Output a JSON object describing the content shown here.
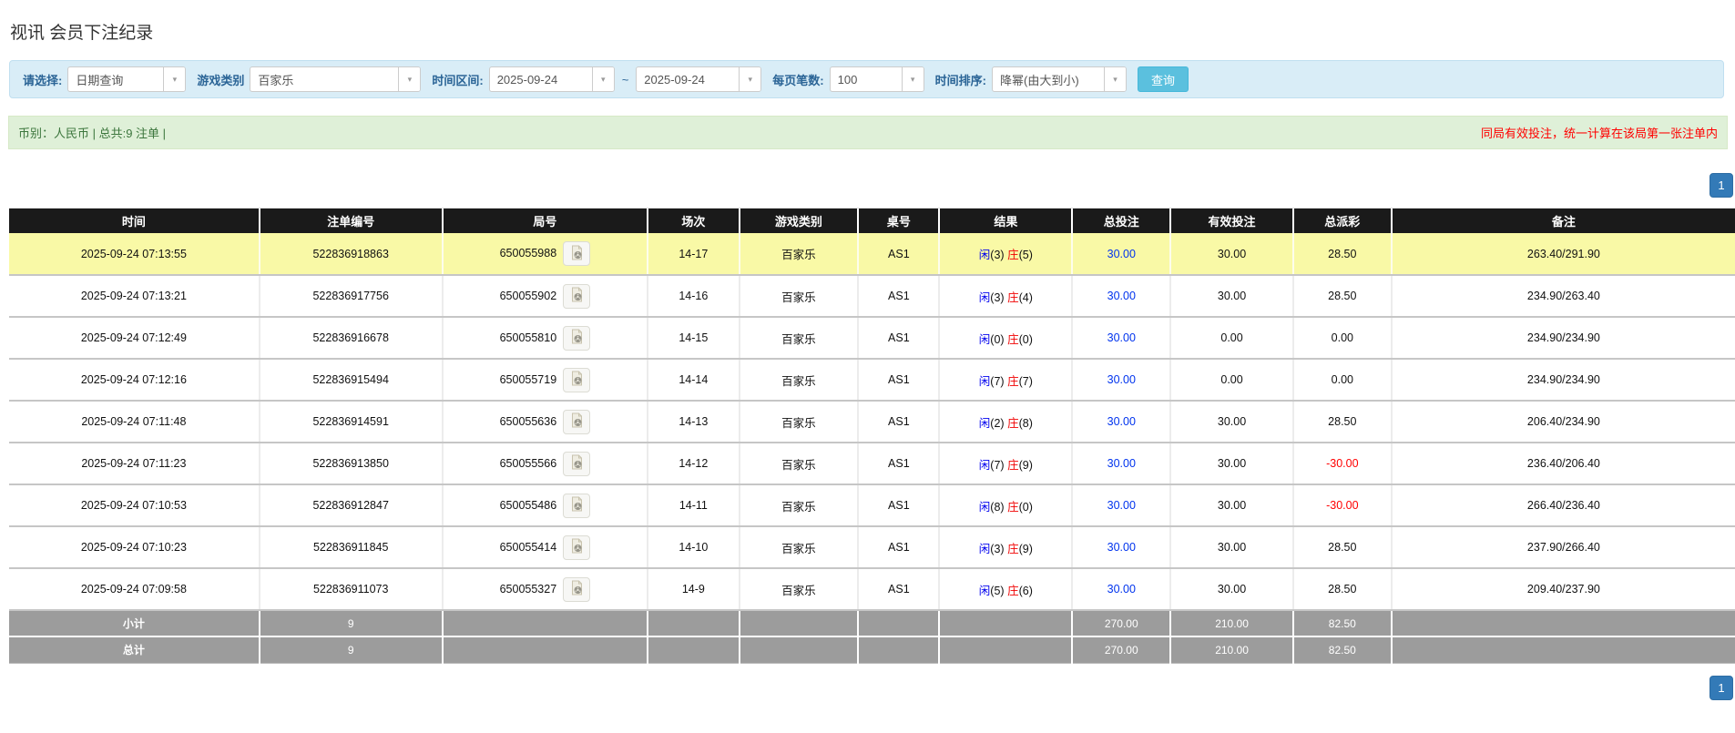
{
  "title": "视讯 会员下注纪录",
  "filters": {
    "query_type": {
      "label": "请选择:",
      "value": "日期查询"
    },
    "game_type": {
      "label": "游戏类别",
      "value": "百家乐"
    },
    "time_range": {
      "label": "时间区间:",
      "from": "2025-09-24",
      "separator": "~",
      "to": "2025-09-24"
    },
    "page_size": {
      "label": "每页笔数:",
      "value": "100"
    },
    "time_sort": {
      "label": "时间排序:",
      "value": "降幂(由大到小)"
    },
    "search_button": "查询"
  },
  "summary": {
    "currency_info": "币别：人民币 | 总共:9 注单 |",
    "note": "同局有效投注，统一计算在该局第一张注单内"
  },
  "pagination": {
    "current_page": "1"
  },
  "table": {
    "headers": [
      "时间",
      "注单编号",
      "局号",
      "场次",
      "游戏类别",
      "桌号",
      "结果",
      "总投注",
      "有效投注",
      "总派彩",
      "备注"
    ],
    "rows": [
      {
        "time": "2025-09-24 07:13:55",
        "bet_no": "522836918863",
        "round_no": "650055988",
        "session": "14-17",
        "game": "百家乐",
        "table_no": "AS1",
        "result": {
          "player": "闲",
          "player_score": "(3)",
          "banker": "庄",
          "banker_score": "(5)"
        },
        "total_bet": "30.00",
        "valid_bet": "30.00",
        "payout": "28.50",
        "remark": "263.40/291.90",
        "highlight": true
      },
      {
        "time": "2025-09-24 07:13:21",
        "bet_no": "522836917756",
        "round_no": "650055902",
        "session": "14-16",
        "game": "百家乐",
        "table_no": "AS1",
        "result": {
          "player": "闲",
          "player_score": "(3)",
          "banker": "庄",
          "banker_score": "(4)"
        },
        "total_bet": "30.00",
        "valid_bet": "30.00",
        "payout": "28.50",
        "remark": "234.90/263.40",
        "highlight": false
      },
      {
        "time": "2025-09-24 07:12:49",
        "bet_no": "522836916678",
        "round_no": "650055810",
        "session": "14-15",
        "game": "百家乐",
        "table_no": "AS1",
        "result": {
          "player": "闲",
          "player_score": "(0)",
          "banker": "庄",
          "banker_score": "(0)"
        },
        "total_bet": "30.00",
        "valid_bet": "0.00",
        "payout": "0.00",
        "remark": "234.90/234.90",
        "highlight": false
      },
      {
        "time": "2025-09-24 07:12:16",
        "bet_no": "522836915494",
        "round_no": "650055719",
        "session": "14-14",
        "game": "百家乐",
        "table_no": "AS1",
        "result": {
          "player": "闲",
          "player_score": "(7)",
          "banker": "庄",
          "banker_score": "(7)"
        },
        "total_bet": "30.00",
        "valid_bet": "0.00",
        "payout": "0.00",
        "remark": "234.90/234.90",
        "highlight": false
      },
      {
        "time": "2025-09-24 07:11:48",
        "bet_no": "522836914591",
        "round_no": "650055636",
        "session": "14-13",
        "game": "百家乐",
        "table_no": "AS1",
        "result": {
          "player": "闲",
          "player_score": "(2)",
          "banker": "庄",
          "banker_score": "(8)"
        },
        "total_bet": "30.00",
        "valid_bet": "30.00",
        "payout": "28.50",
        "remark": "206.40/234.90",
        "highlight": false
      },
      {
        "time": "2025-09-24 07:11:23",
        "bet_no": "522836913850",
        "round_no": "650055566",
        "session": "14-12",
        "game": "百家乐",
        "table_no": "AS1",
        "result": {
          "player": "闲",
          "player_score": "(7)",
          "banker": "庄",
          "banker_score": "(9)"
        },
        "total_bet": "30.00",
        "valid_bet": "30.00",
        "payout": "-30.00",
        "remark": "236.40/206.40",
        "highlight": false
      },
      {
        "time": "2025-09-24 07:10:53",
        "bet_no": "522836912847",
        "round_no": "650055486",
        "session": "14-11",
        "game": "百家乐",
        "table_no": "AS1",
        "result": {
          "player": "闲",
          "player_score": "(8)",
          "banker": "庄",
          "banker_score": "(0)"
        },
        "total_bet": "30.00",
        "valid_bet": "30.00",
        "payout": "-30.00",
        "remark": "266.40/236.40",
        "highlight": false
      },
      {
        "time": "2025-09-24 07:10:23",
        "bet_no": "522836911845",
        "round_no": "650055414",
        "session": "14-10",
        "game": "百家乐",
        "table_no": "AS1",
        "result": {
          "player": "闲",
          "player_score": "(3)",
          "banker": "庄",
          "banker_score": "(9)"
        },
        "total_bet": "30.00",
        "valid_bet": "30.00",
        "payout": "28.50",
        "remark": "237.90/266.40",
        "highlight": false
      },
      {
        "time": "2025-09-24 07:09:58",
        "bet_no": "522836911073",
        "round_no": "650055327",
        "session": "14-9",
        "game": "百家乐",
        "table_no": "AS1",
        "result": {
          "player": "闲",
          "player_score": "(5)",
          "banker": "庄",
          "banker_score": "(6)"
        },
        "total_bet": "30.00",
        "valid_bet": "30.00",
        "payout": "28.50",
        "remark": "209.40/237.90",
        "highlight": false
      }
    ],
    "footer_rows": [
      {
        "label": "小计",
        "count": "9",
        "total_bet": "270.00",
        "valid_bet": "210.00",
        "payout": "82.50"
      },
      {
        "label": "总计",
        "count": "9",
        "total_bet": "270.00",
        "valid_bet": "210.00",
        "payout": "82.50"
      }
    ]
  },
  "icons": {
    "chevron_down": "chevron-down-icon",
    "video_record": "video-record-icon"
  },
  "colors": {
    "filter_bar_bg": "#d9edf7",
    "filter_label_blue": "#2a6496",
    "search_button_bg": "#5bc0de",
    "summary_bar_bg": "#dff0d8",
    "summary_text_green": "#3c763d",
    "note_red": "#ff0000",
    "pagination_blue": "#337ab7",
    "table_header_bg": "#1a1a1a",
    "highlight_row_yellow": "#f9f9a6",
    "footer_row_gray": "#9c9c9c",
    "player_blue": "#0000ee",
    "banker_red": "#f00000",
    "bet_link_blue": "#0033ee",
    "negative_red": "#ff0000"
  }
}
